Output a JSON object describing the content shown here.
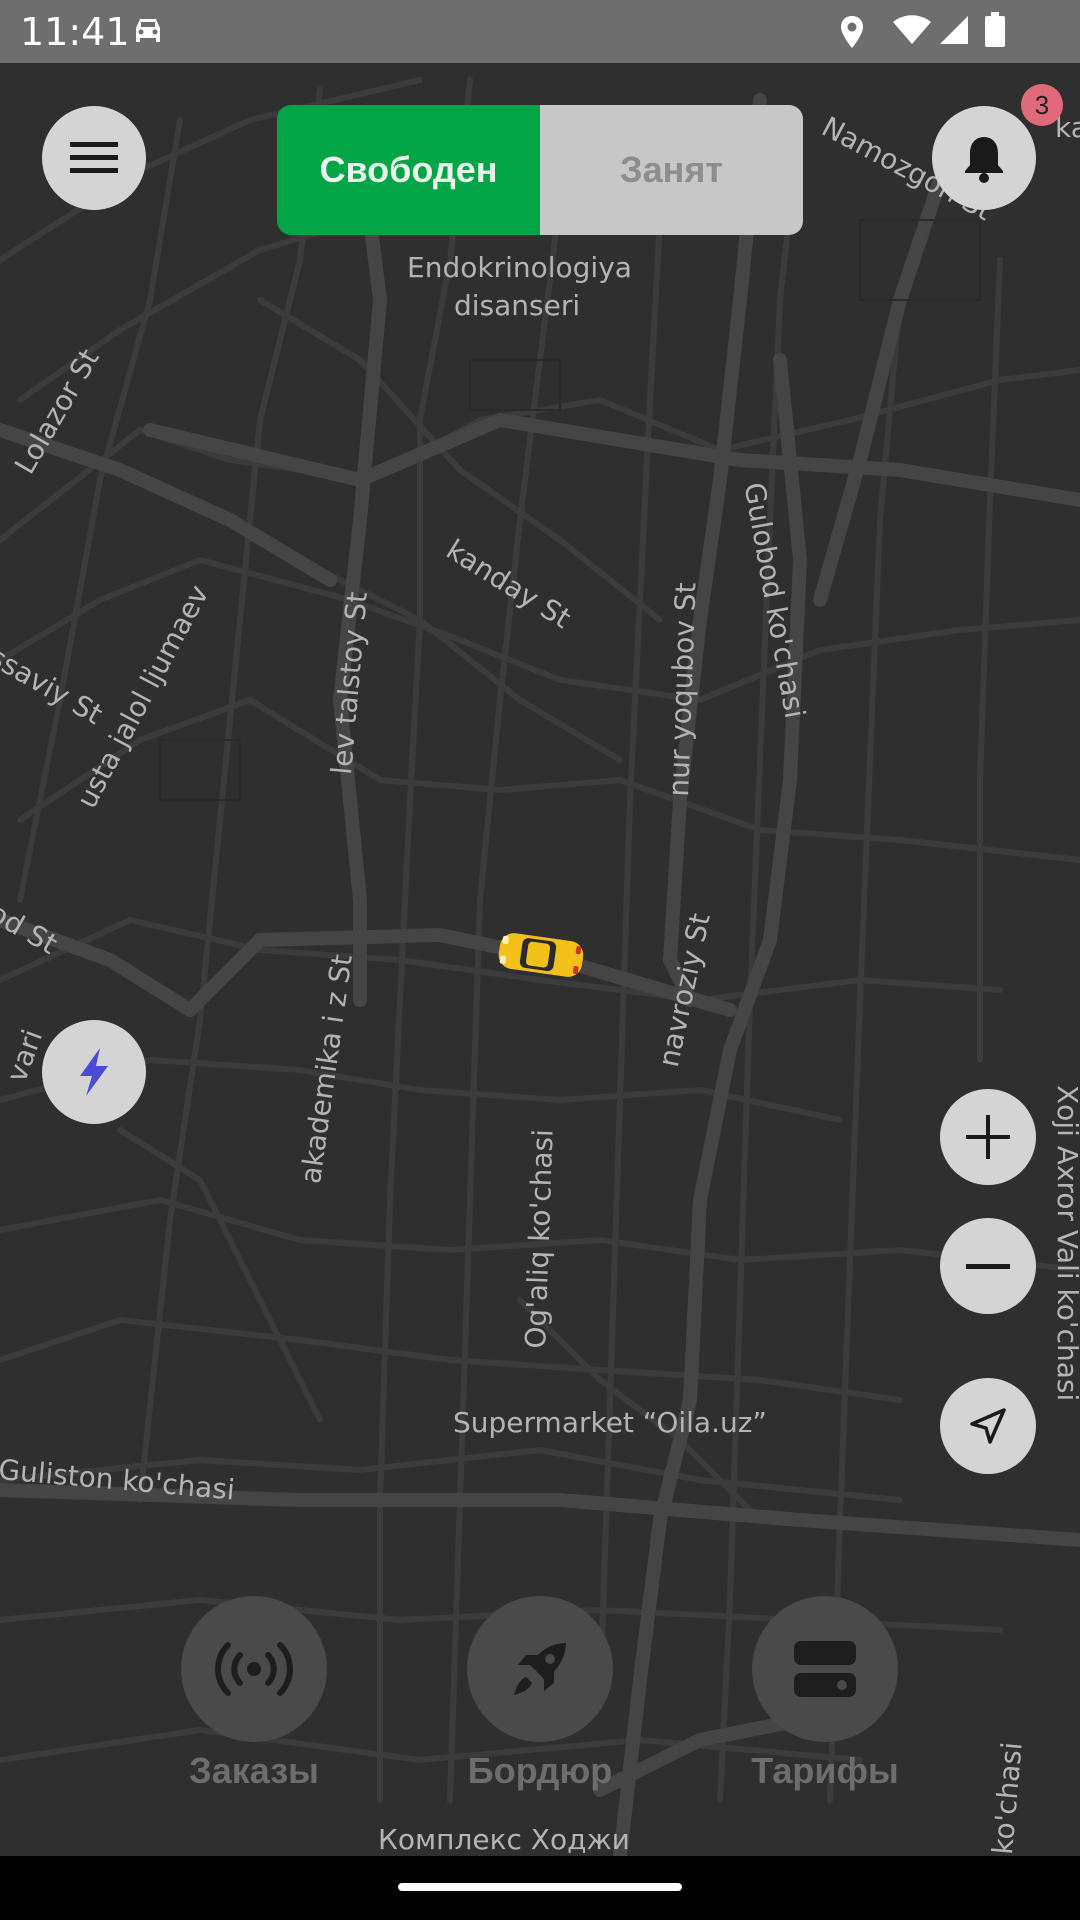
{
  "status_bar": {
    "time": "11:41",
    "icons": [
      "car-icon",
      "location-icon",
      "wifi-icon",
      "signal-icon",
      "battery-icon"
    ]
  },
  "toggle": {
    "free_label": "Свободен",
    "busy_label": "Занят",
    "selected": "free",
    "colors": {
      "free": "#01a545",
      "busy": "#c7c7c7"
    }
  },
  "notifications": {
    "count": "3"
  },
  "map": {
    "labels": {
      "endokrinologiya": "Endokrinologiya",
      "disanseri": "disanseri",
      "namozgoh": "Namozgoh St",
      "lolazor": "Lolazor St",
      "gulobod": "Gulobod ko'chasi",
      "kanday": "kanday St",
      "nur_yoqubov": "nur yoqubov St",
      "lev_talstoy": "lev talstoy St",
      "usta_jalol": "usta jalol ljumaev",
      "savaiy": "ssaviy St",
      "od_st": "od St",
      "navroziy": "navroziy St",
      "akademika": "akademika i z St",
      "ogaliq": "Og'aliq ko'chasi",
      "xoji_axror": "Xoji Axror Vali ko'chasi",
      "supermarket": "Supermarket “Oila.uz”",
      "guliston": "Guliston ko'chasi",
      "kompleks": "Комплекс Ходжи",
      "vari": "vari",
      "ka": "ka",
      "ko_chasi": "ko'chasi"
    }
  },
  "bottom_nav": {
    "orders_label": "Заказы",
    "border_label": "Бордюр",
    "tariffs_label": "Тарифы"
  }
}
